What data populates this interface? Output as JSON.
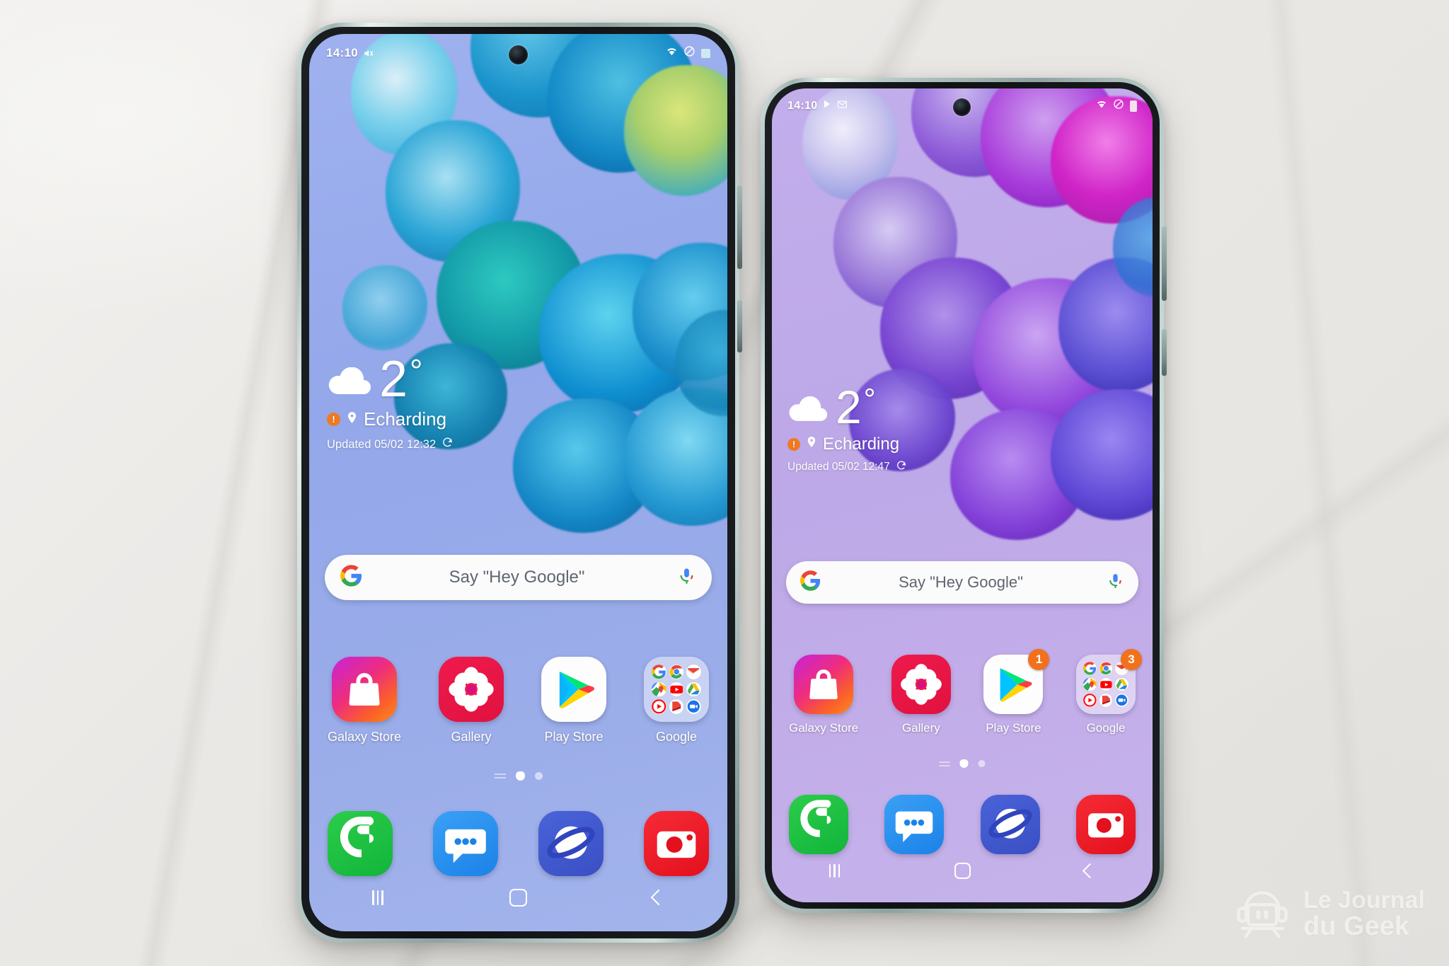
{
  "scene": {
    "background": "white-marble-surface",
    "background_color": "#eceae7",
    "device_count": 2
  },
  "watermark": {
    "line1": "Le Journal",
    "line2": "du Geek",
    "logo": "robot-head-with-headphones-icon"
  },
  "phones": [
    {
      "id": "phone-left",
      "model_size": "larger",
      "frame_color": "#b9cbc8",
      "wallpaper": {
        "style": "chrysanthemum-flowers",
        "base_color": "#9aace9",
        "accent_colors": [
          "#1fa9d6",
          "#0d6ea8",
          "#1ec8c0",
          "#d7e36a",
          "#ffffff"
        ]
      },
      "status_bar": {
        "time": "14:10",
        "left_icons": [
          "volume-mute-icon"
        ],
        "right_icons": [
          "wifi-icon",
          "do-not-disturb-icon",
          "battery-icon"
        ]
      },
      "weather_widget": {
        "condition_icon": "cloud-icon",
        "temperature": "2",
        "degree_symbol": "°",
        "alert_icon": "alert-circle-icon",
        "location_icon": "location-pin-icon",
        "location": "Echarding",
        "updated_label": "Updated 05/02 12:32",
        "refresh_icon": "refresh-icon"
      },
      "search_bar": {
        "leading_icon": "google-g-icon",
        "placeholder": "Say \"Hey Google\"",
        "trailing_icon": "microphone-icon"
      },
      "apps": [
        {
          "label": "Galaxy Store",
          "icon": "galaxy-store-icon",
          "badge": ""
        },
        {
          "label": "Gallery",
          "icon": "gallery-icon",
          "badge": ""
        },
        {
          "label": "Play Store",
          "icon": "play-store-icon",
          "badge": ""
        },
        {
          "label": "Google",
          "icon": "google-folder-icon",
          "badge": ""
        }
      ],
      "folder_apps": [
        "Google",
        "Chrome",
        "Gmail",
        "Maps",
        "YouTube",
        "Drive",
        "YT Music",
        "Play Movies",
        "Duo"
      ],
      "page_indicator": {
        "pages": 3,
        "active_index": 1
      },
      "dock": [
        {
          "label": "Phone",
          "icon": "phone-icon"
        },
        {
          "label": "Messages",
          "icon": "messages-icon"
        },
        {
          "label": "Internet",
          "icon": "internet-browser-icon"
        },
        {
          "label": "Camera",
          "icon": "camera-icon"
        }
      ],
      "nav_bar": {
        "recents": "recents-icon",
        "home": "home-icon",
        "back": "back-icon"
      }
    },
    {
      "id": "phone-right",
      "model_size": "smaller",
      "frame_color": "#cfe0dc",
      "wallpaper": {
        "style": "chrysanthemum-flowers",
        "base_color": "#c2ade9",
        "accent_colors": [
          "#8a3fd4",
          "#c026d3",
          "#5b35c8",
          "#d9d0f5",
          "#ffffff"
        ]
      },
      "status_bar": {
        "time": "14:10",
        "left_icons": [
          "play-store-icon",
          "gmail-icon"
        ],
        "right_icons": [
          "wifi-icon",
          "do-not-disturb-icon",
          "battery-icon"
        ]
      },
      "weather_widget": {
        "condition_icon": "cloud-icon",
        "temperature": "2",
        "degree_symbol": "°",
        "alert_icon": "alert-circle-icon",
        "location_icon": "location-pin-icon",
        "location": "Echarding",
        "updated_label": "Updated 05/02 12:47",
        "refresh_icon": "refresh-icon"
      },
      "search_bar": {
        "leading_icon": "google-g-icon",
        "placeholder": "Say \"Hey Google\"",
        "trailing_icon": "microphone-icon"
      },
      "apps": [
        {
          "label": "Galaxy Store",
          "icon": "galaxy-store-icon",
          "badge": ""
        },
        {
          "label": "Gallery",
          "icon": "gallery-icon",
          "badge": ""
        },
        {
          "label": "Play Store",
          "icon": "play-store-icon",
          "badge": "1"
        },
        {
          "label": "Google",
          "icon": "google-folder-icon",
          "badge": "3"
        }
      ],
      "folder_apps": [
        "Google",
        "Chrome",
        "Gmail",
        "Maps",
        "YouTube",
        "Drive",
        "YT Music",
        "Play Movies",
        "Duo"
      ],
      "page_indicator": {
        "pages": 3,
        "active_index": 1
      },
      "dock": [
        {
          "label": "Phone",
          "icon": "phone-icon"
        },
        {
          "label": "Messages",
          "icon": "messages-icon"
        },
        {
          "label": "Internet",
          "icon": "internet-browser-icon"
        },
        {
          "label": "Camera",
          "icon": "camera-icon"
        }
      ],
      "nav_bar": {
        "recents": "recents-icon",
        "home": "home-icon",
        "back": "back-icon"
      }
    }
  ],
  "colors": {
    "badge_orange": "#f2711c",
    "alert_orange": "#f07a22",
    "search_pill": "#fbfbfb",
    "search_text": "#5f6571"
  }
}
